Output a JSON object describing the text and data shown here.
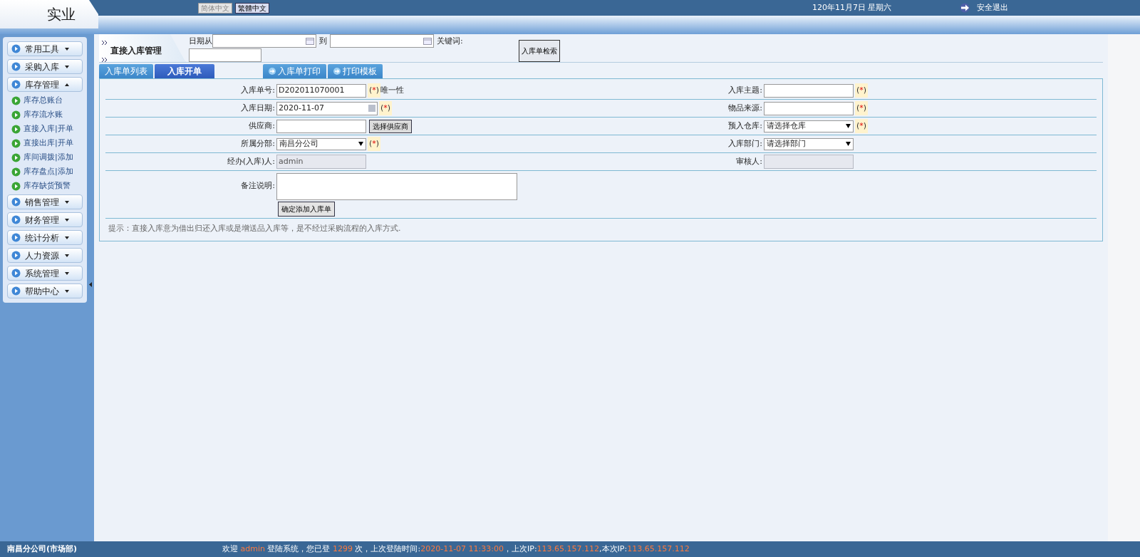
{
  "header": {
    "logo": "实业",
    "languages": [
      {
        "label": "简体中文",
        "selected": false
      },
      {
        "label": "繁體中文",
        "selected": true
      }
    ],
    "date": "120年11月7日 星期六",
    "logout": "安全退出"
  },
  "sidebar": {
    "groups": [
      {
        "label": "常用工具",
        "expanded": false
      },
      {
        "label": "采购入库",
        "expanded": false
      },
      {
        "label": "库存管理",
        "expanded": true,
        "children": [
          {
            "label": "库存总账台"
          },
          {
            "label": "库存流水账"
          },
          {
            "label": "直接入库|开单"
          },
          {
            "label": "直接出库|开单"
          },
          {
            "label": "库间调拨|添加"
          },
          {
            "label": "库存盘点|添加"
          },
          {
            "label": "库存缺货预警"
          }
        ]
      },
      {
        "label": "销售管理",
        "expanded": false
      },
      {
        "label": "财务管理",
        "expanded": false
      },
      {
        "label": "统计分析",
        "expanded": false
      },
      {
        "label": "人力资源",
        "expanded": false
      },
      {
        "label": "系统管理",
        "expanded": false
      },
      {
        "label": "帮助中心",
        "expanded": false
      }
    ]
  },
  "search": {
    "title": "直接入库管理",
    "date_from_label": "日期从",
    "date_to_label": "到",
    "keyword_label": "关键词:",
    "button": "入库单检索"
  },
  "tabs": [
    {
      "label": "入库单列表",
      "selected": false,
      "icon": false
    },
    {
      "label": "入库开单",
      "selected": true,
      "icon": false
    },
    {
      "label": "入库单打印",
      "selected": false,
      "icon": true
    },
    {
      "label": "打印模板",
      "selected": false,
      "icon": true
    }
  ],
  "form": {
    "rows": [
      [
        {
          "label": "入库单号:",
          "kind": "text",
          "value": "D202011070001",
          "mark": "(*)",
          "note": "唯一性"
        },
        {
          "label": "入库主题:",
          "kind": "text",
          "mark": "(*)"
        }
      ],
      [
        {
          "label": "入库日期:",
          "kind": "date",
          "value": "2020-11-07",
          "mark": "(*)"
        },
        {
          "label": "物品来源:",
          "kind": "text",
          "mark": "(*)"
        }
      ],
      [
        {
          "label": "供应商:",
          "kind": "text",
          "button": "选择供应商"
        },
        {
          "label": "预入仓库:",
          "kind": "select",
          "value": "请选择仓库",
          "mark": "(*)"
        }
      ],
      [
        {
          "label": "所属分部:",
          "kind": "select",
          "value": "南昌分公司",
          "mark": "(*)"
        },
        {
          "label": "入库部门:",
          "kind": "select",
          "value": "请选择部门"
        }
      ],
      [
        {
          "label": "经办(入库)人:",
          "kind": "readonly",
          "value": "admin"
        },
        {
          "label": "审核人:",
          "kind": "readonly"
        }
      ]
    ],
    "remark_label": "备注说明:",
    "submit": "确定添加入库单",
    "tip": "提示：直接入库意为借出归还入库或是增送品入库等，是不经过采购流程的入库方式."
  },
  "footer": {
    "branch": "南昌分公司(市场部)",
    "welcome": [
      {
        "text": "欢迎 ",
        "highlight": false
      },
      {
        "text": "admin",
        "highlight": true
      },
      {
        "text": " 登陆系统，您已登 ",
        "highlight": false
      },
      {
        "text": "1299",
        "highlight": true
      },
      {
        "text": " 次，上次登陆时间:",
        "highlight": false
      },
      {
        "text": "2020-11-07 11:33:00",
        "highlight": true
      },
      {
        "text": "，上次IP:",
        "highlight": false
      },
      {
        "text": "113.65.157.112",
        "highlight": true
      },
      {
        "text": ",本次IP:",
        "highlight": false
      },
      {
        "text": "113.65.157.112",
        "highlight": true
      }
    ]
  }
}
